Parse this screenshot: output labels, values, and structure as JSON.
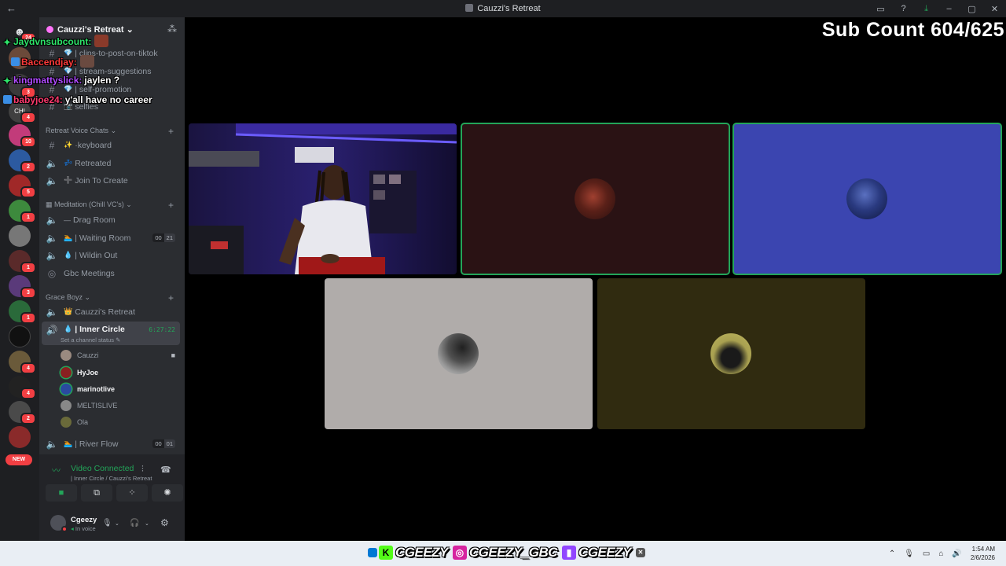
{
  "window": {
    "title": "Cauzzi's Retreat"
  },
  "server": {
    "name": "Cauzzi's Retreat",
    "rail_badges": [
      "24",
      "3",
      "4",
      "10",
      "2",
      "5",
      "1",
      "1",
      "1",
      "3",
      "1",
      "4",
      "4",
      "2"
    ],
    "new_label": "NEW"
  },
  "channels": {
    "text": [
      {
        "name": "| clips-to-post-on-tiktok"
      },
      {
        "name": "| stream-suggestions"
      },
      {
        "name": "| self-promotion"
      },
      {
        "name": "selfies"
      }
    ],
    "retreat_category": "Retreat Voice Chats",
    "retreat": [
      {
        "name": "keyboard",
        "emoji": "✨",
        "prefix": "· "
      },
      {
        "name": "Retreated",
        "emoji": "💤"
      },
      {
        "name": "Join To Create",
        "emoji": "➕"
      }
    ],
    "meditation_category": "Meditation (Chill VC's)",
    "meditation": [
      {
        "name": "Drag Room",
        "emoji": "—"
      },
      {
        "name": "| Waiting Room",
        "emoji": "🏊",
        "count_a": "00",
        "count_b": "21"
      },
      {
        "name": "| Wildin Out",
        "emoji": "💧"
      },
      {
        "name": "Gbc Meetings"
      }
    ],
    "grace_category": "Grace Boyz",
    "grace": [
      {
        "name": "Cauzzi's Retreat",
        "emoji": "👑"
      },
      {
        "name": "| Inner Circle",
        "emoji": "💧",
        "time": "6:27:22",
        "status": "Set a channel status"
      }
    ],
    "voice_users": [
      {
        "name": "Cauzzi"
      },
      {
        "name": "HyJoe"
      },
      {
        "name": "marinotlive"
      },
      {
        "name": "MELTISLIVE"
      },
      {
        "name": "Ola"
      }
    ],
    "river": {
      "name": "| River Flow",
      "count_a": "00",
      "count_b": "01"
    }
  },
  "voice_panel": {
    "status": "Video Connected",
    "channel": "| Inner Circle / Cauzzi's Retreat"
  },
  "user": {
    "name": "Cgeezy",
    "status": "In voice"
  },
  "chat": [
    {
      "user": "Jaydvnsubcount",
      "sep": ":",
      "msg": "",
      "color": "#2ee56a"
    },
    {
      "user": "Baccendjay",
      "sep": ":",
      "msg": "",
      "color": "#ff3a3a"
    },
    {
      "user": "kingmattyslick",
      "sep": ":",
      "msg": "jaylen ?",
      "color": "#b04bff"
    },
    {
      "user": "babyjoe24",
      "sep": ":",
      "msg": "y'all have no career",
      "color": "#ff3a6e"
    }
  ],
  "overlay": {
    "sub_count": "Sub Count 604/625"
  },
  "banner": [
    {
      "platform": "kick",
      "handle": "CGEEZY",
      "color": "#53fc18",
      "glyph": "K"
    },
    {
      "platform": "instagram",
      "handle": "CGEEZY_GBC",
      "color": "#d6249f",
      "glyph": "◎"
    },
    {
      "platform": "twitch",
      "handle": "CGEEZY",
      "color": "#9146ff",
      "glyph": "▮"
    }
  ],
  "clock": {
    "time": "1:54 AM",
    "date": "2/6/2026"
  }
}
